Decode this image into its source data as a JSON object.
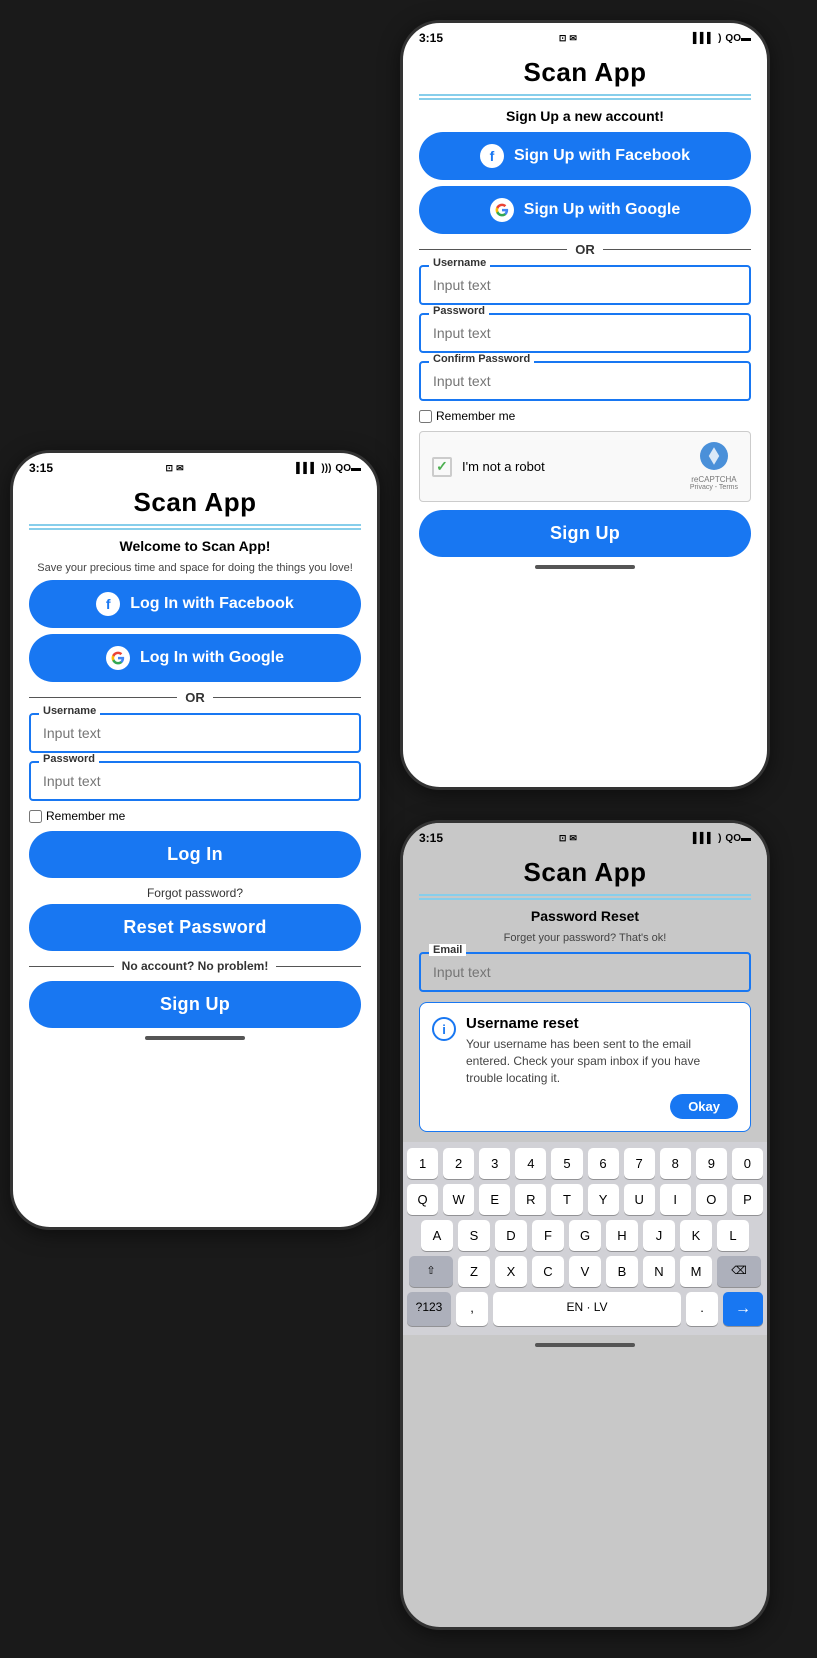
{
  "app": {
    "title": "Scan App"
  },
  "status_bar": {
    "time": "3:15",
    "icons_left": "⊡ ✉",
    "icons_right": "▌▌▌ ))) QO ▬"
  },
  "login_screen": {
    "title": "Scan App",
    "welcome": "Welcome to Scan App!",
    "subtitle": "Save your precious time and space for doing the things you love!",
    "facebook_btn": "Log In with Facebook",
    "google_btn": "Log In with Google",
    "or": "OR",
    "username_label": "Username",
    "username_placeholder": "Input text",
    "password_label": "Password",
    "password_placeholder": "Input text",
    "remember_me": "Remember me",
    "login_btn": "Log In",
    "forgot": "Forgot password?",
    "reset_btn": "Reset Password",
    "no_account": "No account? No problem!",
    "signup_btn": "Sign Up"
  },
  "signup_screen": {
    "title": "Scan App",
    "subtitle": "Sign Up a new account!",
    "facebook_btn": "Sign Up with Facebook",
    "google_btn": "Sign Up with Google",
    "or": "OR",
    "username_label": "Username",
    "username_placeholder": "Input text",
    "password_label": "Password",
    "password_placeholder": "Input text",
    "confirm_label": "Confirm Password",
    "confirm_placeholder": "Input text",
    "remember_me": "Remember me",
    "captcha_text": "I'm not a robot",
    "captcha_brand": "reCAPTCHA",
    "captcha_links": "Privacy - Terms",
    "signup_btn": "Sign Up"
  },
  "reset_screen": {
    "title": "Scan App",
    "heading": "Password Reset",
    "subtitle": "Forget your password? That's ok!",
    "email_label": "Email",
    "email_placeholder": "Input text",
    "alert_title": "Username reset",
    "alert_text": "Your username has been sent to the email entered. Check your spam inbox if you have trouble locating it.",
    "okay_btn": "Okay"
  },
  "keyboard": {
    "row1": [
      "1",
      "2",
      "3",
      "4",
      "5",
      "6",
      "7",
      "8",
      "9",
      "0"
    ],
    "row2": [
      "Q",
      "W",
      "E",
      "R",
      "T",
      "Y",
      "U",
      "I",
      "O",
      "P"
    ],
    "row3": [
      "A",
      "S",
      "D",
      "F",
      "G",
      "H",
      "J",
      "K",
      "L"
    ],
    "row4": [
      "Z",
      "X",
      "C",
      "V",
      "B",
      "N",
      "M"
    ],
    "space_label": "EN · LV",
    "numbers_label": "?123",
    "comma": ",",
    "period": ".",
    "delete": "⌫",
    "shift": "⇧",
    "enter": "→"
  }
}
